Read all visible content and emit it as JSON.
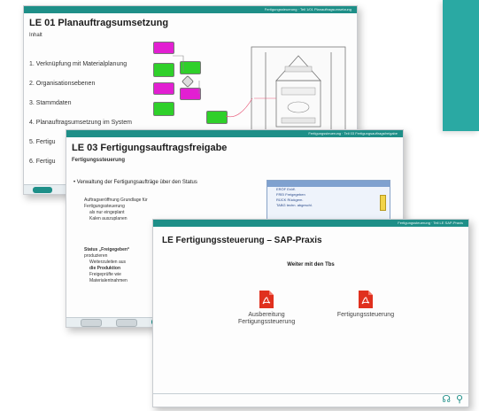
{
  "slide1": {
    "header_text": "Fertigungssteuerung · Teil 1/01 Planauftragsumsetzung",
    "title": "LE 01 Planauftragsumsetzung",
    "subtitle": "Inhalt",
    "items": [
      "1.  Verknüpfung mit Materialplanung",
      "2.  Organisationsebenen",
      "3.  Stammdaten",
      "4.  Planauftragsumsetzung im System",
      "5.  Fertigu",
      "6.  Fertigu"
    ]
  },
  "slide2": {
    "header_text": "Fertigungssteuerung · Teil 03 Fertigungsauftragsfreigabe",
    "title": "LE 03 Fertigungsauftragsfreigabe",
    "subtitle": "Fertigungssteuerung",
    "bullet_main": "Verwaltung der Fertigungsaufträge über den Status",
    "bullet_a": "Auftragseröffnung Grundlage für",
    "bullet_a2": "Fertigungssteuerung",
    "bullet_a3": "als nur eingeplant",
    "bullet_a4": "Kalen auszuplanen",
    "bullet_b": "Status „Freigegeben“",
    "bullet_b2": "produzieren",
    "bullet_b3": "Weiterzuleiten aus",
    "bullet_b4": "die Produktion",
    "bullet_b5": "Freigeprüfte wie",
    "bullet_b6": "Materialentnahmen",
    "status_box": {
      "rows": [
        "ERÖF  Eröff.",
        "FREI  Freigegeben",
        "RÜCK  Rückgem.",
        "TABG  techn. abgeschl."
      ]
    }
  },
  "slide3": {
    "header_text": "Fertigungssteuerung · Teil LE SAP-Praxis",
    "title": "LE Fertigungssteuerung – SAP-Praxis",
    "subheading": "Weiter mit den Tbs",
    "doc1_label_line1": "Ausbereitung",
    "doc1_label_line2": "Fertigungssteuerung",
    "doc2_label": "Fertigungssteuerung",
    "icon_pdf_1": "pdf-icon",
    "icon_pdf_2": "pdf-icon"
  },
  "colors": {
    "teal": "#1e8f88",
    "teal_block": "#2aa9a3",
    "magenta": "#e21fd2",
    "green": "#2fd02a",
    "pdf_red": "#e0301e"
  }
}
